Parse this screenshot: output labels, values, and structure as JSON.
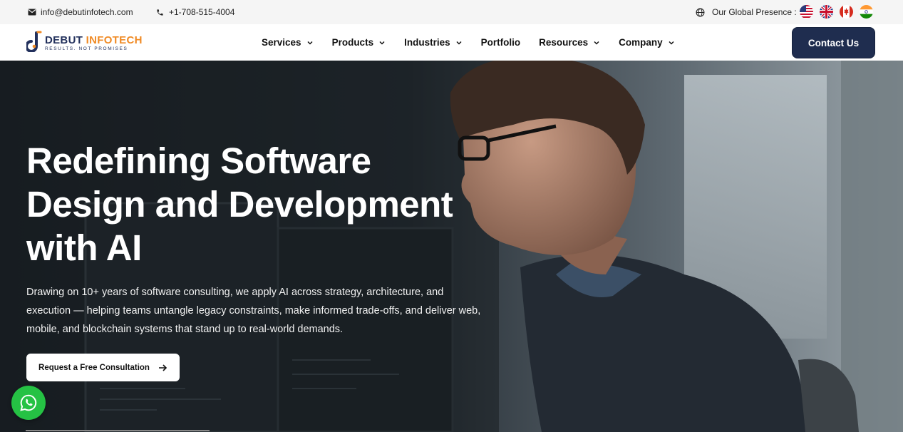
{
  "topbar": {
    "email": "info@debutinfotech.com",
    "phone": "+1-708-515-4004",
    "presence_label": "Our Global Presence :",
    "flags": [
      "us-flag-icon",
      "uk-flag-icon",
      "canada-flag-icon",
      "india-flag-icon"
    ]
  },
  "nav": {
    "logo_main_1": "DEBUT",
    "logo_main_2": "INFOTECH",
    "logo_sub": "RESULTS. NOT PROMISES",
    "items": [
      {
        "label": "Services",
        "dropdown": true
      },
      {
        "label": "Products",
        "dropdown": true
      },
      {
        "label": "Industries",
        "dropdown": true
      },
      {
        "label": "Portfolio",
        "dropdown": false
      },
      {
        "label": "Resources",
        "dropdown": true
      },
      {
        "label": "Company",
        "dropdown": true
      }
    ],
    "contact_label": "Contact Us"
  },
  "hero": {
    "title_lines": [
      "Redefining Software",
      "Design and Development",
      "with AI"
    ],
    "desc_lines": [
      "Drawing on 10+ years of software consulting, we apply AI across strategy, architecture, and",
      "execution — helping teams untangle legacy constraints, make informed trade-offs, and deliver web,",
      "mobile, and blockchain systems that stand up to real-world demands."
    ],
    "cta_label": "Request a Free Consultation"
  },
  "colors": {
    "brand_navy": "#1f2d4f",
    "brand_orange": "#f08a24",
    "whatsapp_green": "#25c244"
  }
}
